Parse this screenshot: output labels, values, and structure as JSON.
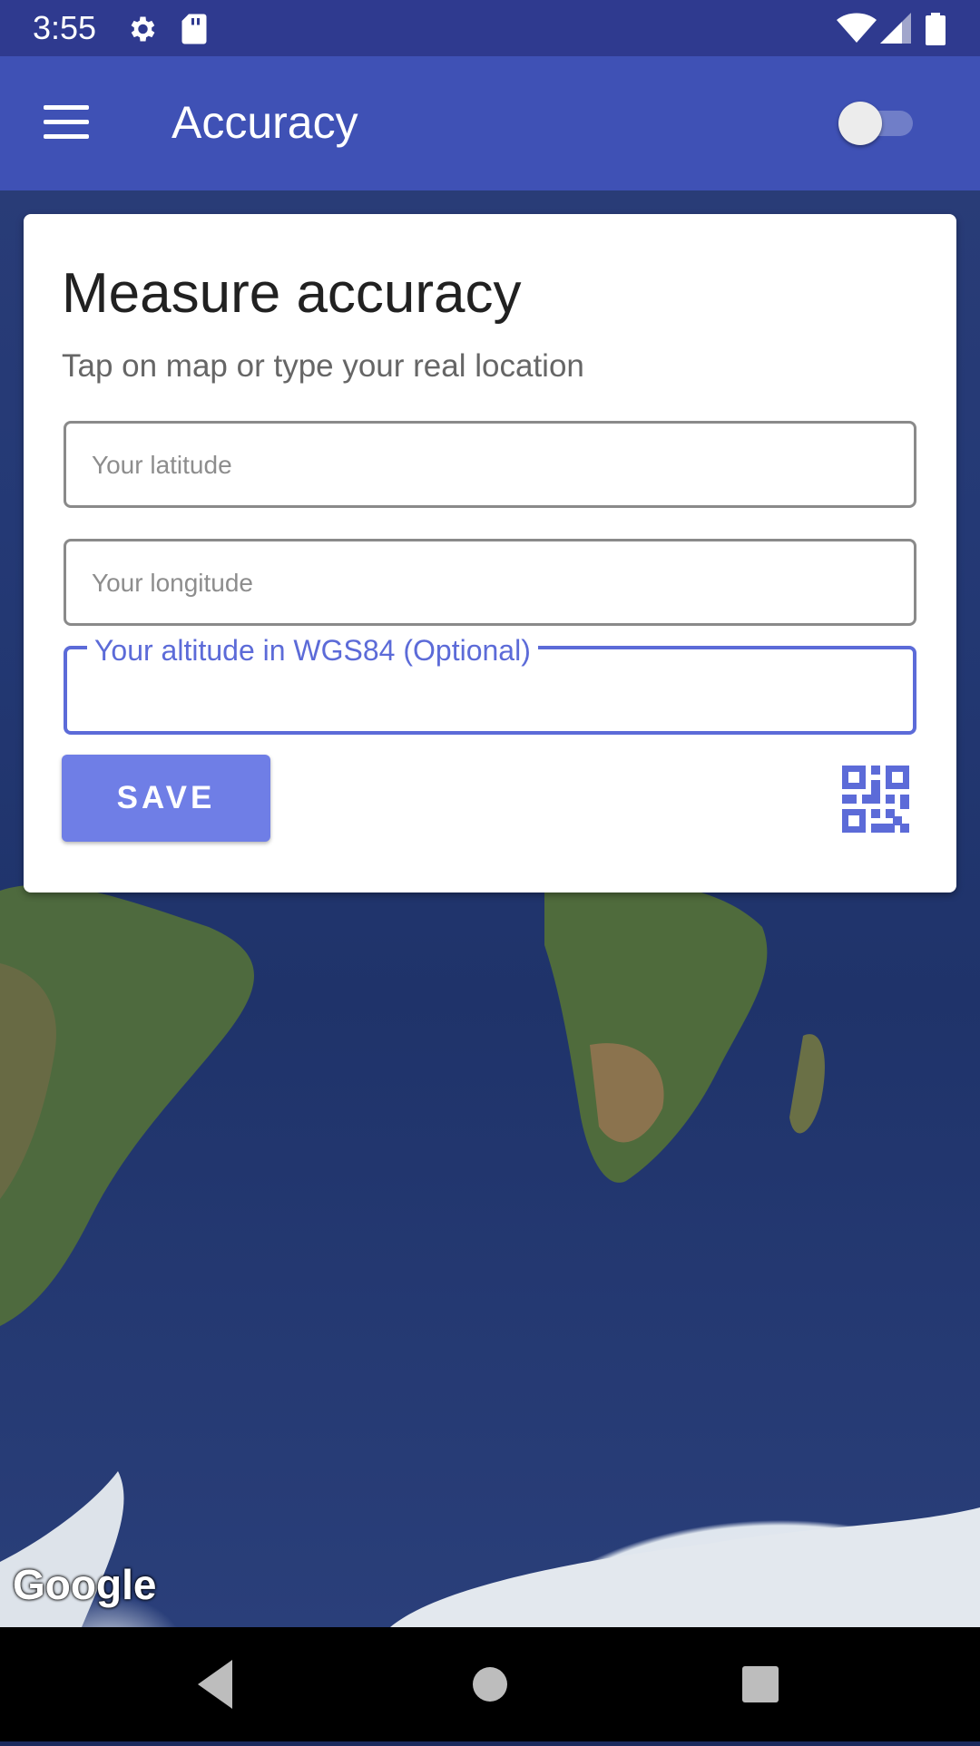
{
  "status_bar": {
    "time": "3:55",
    "icons": [
      "gear-icon",
      "sd-card-icon",
      "wifi-icon",
      "signal-icon",
      "battery-icon"
    ]
  },
  "app_bar": {
    "title": "Accuracy",
    "menu_icon": "hamburger-menu-icon",
    "toggle_on": false
  },
  "card": {
    "title": "Measure accuracy",
    "subtitle": "Tap on map or type your real location",
    "latitude": {
      "placeholder": "Your latitude",
      "value": ""
    },
    "longitude": {
      "placeholder": "Your longitude",
      "value": ""
    },
    "altitude": {
      "label": "Your altitude in WGS84 (Optional)",
      "value": ""
    },
    "save_label": "SAVE",
    "qr_icon": "qr-code-icon"
  },
  "map": {
    "attribution": "Google"
  },
  "nav_bar": {
    "icons": [
      "back-icon",
      "home-icon",
      "recents-icon"
    ]
  },
  "colors": {
    "status_bar": "#2f3a8f",
    "app_bar": "#3f51b5",
    "accent": "#5c6bd8",
    "save_button": "#6f7ee6"
  }
}
